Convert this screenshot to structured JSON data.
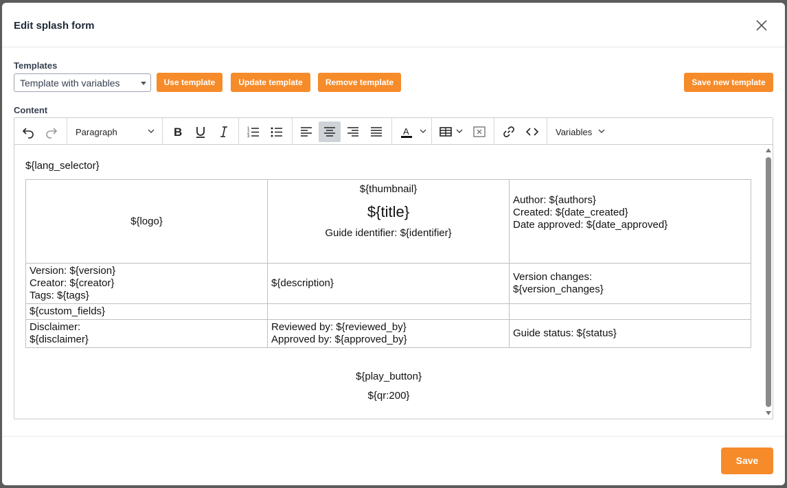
{
  "dialog": {
    "title": "Edit splash form",
    "save_label": "Save"
  },
  "templates": {
    "label": "Templates",
    "selected": "Template with variables",
    "use_label": "Use template",
    "update_label": "Update template",
    "remove_label": "Remove template",
    "save_new_label": "Save new template"
  },
  "content": {
    "label": "Content",
    "toolbar": {
      "block_format": "Paragraph",
      "variables_label": "Variables"
    },
    "lang_selector": "${lang_selector}",
    "table": {
      "r1": {
        "logo": "${logo}",
        "thumbnail": "${thumbnail}",
        "title": "${title}",
        "identifier": "Guide identifier: ${identifier}",
        "authors": "Author: ${authors}",
        "created": "Created: ${date_created}",
        "approved": "Date approved: ${date_approved}"
      },
      "r2": {
        "version": "Version: ${version}",
        "creator": "Creator: ${creator}",
        "tags": "Tags: ${tags}",
        "description": "${description}",
        "changes_label": "Version changes:",
        "changes": "${version_changes}"
      },
      "r3": {
        "custom_fields": "${custom_fields}"
      },
      "r4": {
        "disclaimer_label": "Disclaimer:",
        "disclaimer": "${disclaimer}",
        "reviewed": "Reviewed by: ${reviewed_by}",
        "approved_by": "Approved by: ${approved_by}",
        "status": "Guide status: ${status}"
      }
    },
    "play_button": "${play_button}",
    "qr": "${qr:200}"
  },
  "colors": {
    "accent": "#f68b2a",
    "active_tool": "#cfd3d8"
  }
}
